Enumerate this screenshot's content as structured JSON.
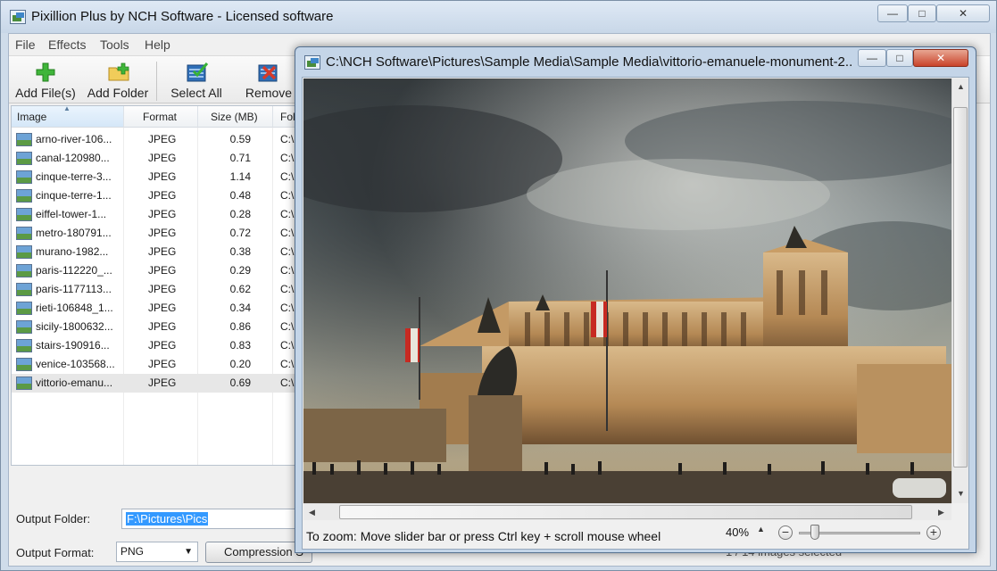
{
  "main_window": {
    "title": "Pixillion Plus by NCH Software - Licensed software",
    "caption": {
      "minimize": "—",
      "maximize": "□",
      "close": "✕"
    }
  },
  "menu": [
    "File",
    "Effects",
    "Tools",
    "Help"
  ],
  "toolbar": [
    {
      "label": "Add File(s)",
      "icon": "add-file-icon"
    },
    {
      "label": "Add Folder",
      "icon": "add-folder-icon"
    },
    {
      "label": "Select All",
      "icon": "select-all-icon"
    },
    {
      "label": "Remove",
      "icon": "remove-icon"
    }
  ],
  "file_list": {
    "columns": [
      "Image",
      "Format",
      "Size (MB)",
      "Folder"
    ],
    "folder_prefix": "C:\\",
    "rows": [
      {
        "name": "arno-river-106...",
        "format": "JPEG",
        "size": "0.59"
      },
      {
        "name": "canal-120980...",
        "format": "JPEG",
        "size": "0.71"
      },
      {
        "name": "cinque-terre-3...",
        "format": "JPEG",
        "size": "1.14"
      },
      {
        "name": "cinque-terre-1...",
        "format": "JPEG",
        "size": "0.48"
      },
      {
        "name": "eiffel-tower-1...",
        "format": "JPEG",
        "size": "0.28"
      },
      {
        "name": "metro-180791...",
        "format": "JPEG",
        "size": "0.72"
      },
      {
        "name": "murano-1982...",
        "format": "JPEG",
        "size": "0.38"
      },
      {
        "name": "paris-112220_...",
        "format": "JPEG",
        "size": "0.29"
      },
      {
        "name": "paris-1177113...",
        "format": "JPEG",
        "size": "0.62"
      },
      {
        "name": "rieti-106848_1...",
        "format": "JPEG",
        "size": "0.34"
      },
      {
        "name": "sicily-1800632...",
        "format": "JPEG",
        "size": "0.86"
      },
      {
        "name": "stairs-190916...",
        "format": "JPEG",
        "size": "0.83"
      },
      {
        "name": "venice-103568...",
        "format": "JPEG",
        "size": "0.20"
      },
      {
        "name": "vittorio-emanu...",
        "format": "JPEG",
        "size": "0.69",
        "selected": true
      }
    ]
  },
  "output": {
    "folder_label": "Output Folder:",
    "folder_value": "F:\\Pictures\\Pics",
    "format_label": "Output Format:",
    "format_value": "PNG",
    "compression_label": "Compression S"
  },
  "status": "1 / 14 images selected",
  "preview_window": {
    "title": "C:\\NCH Software\\Pictures\\Sample Media\\Sample Media\\vittorio-emanuele-monument-2...",
    "zoom_hint": "To zoom: Move slider bar or press Ctrl key + scroll mouse wheel",
    "zoom_value": "40%",
    "zoom_level_fraction": 0.1
  }
}
